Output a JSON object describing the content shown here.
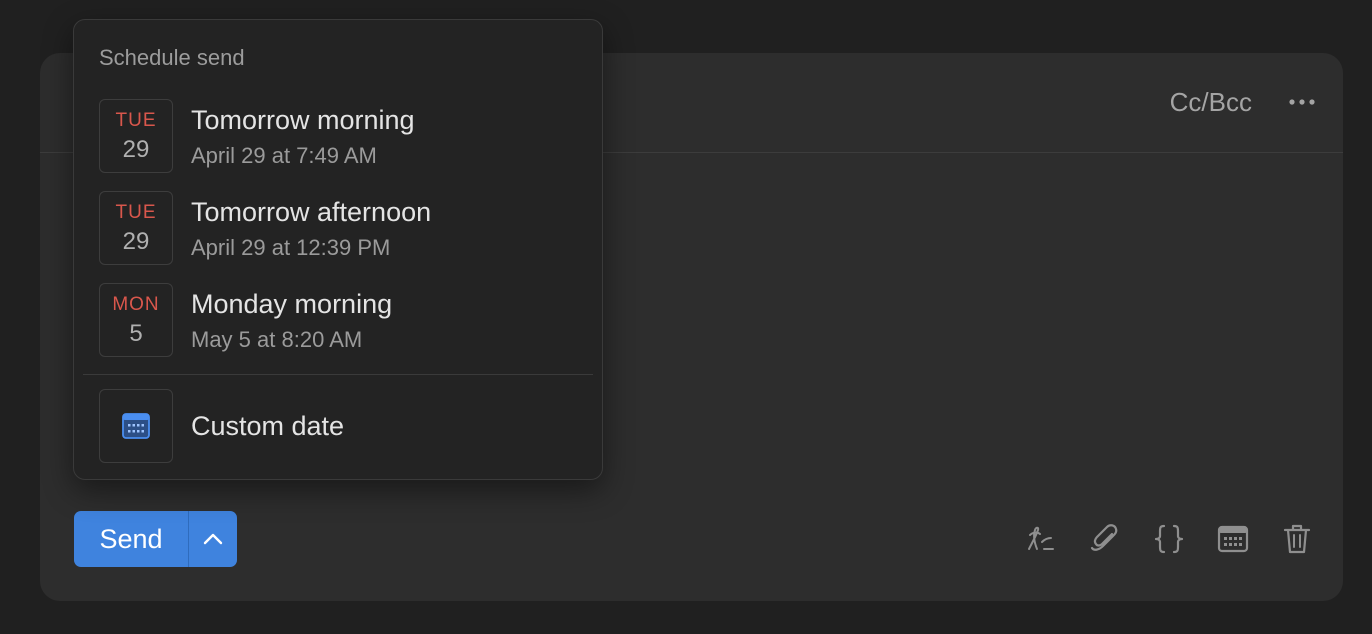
{
  "composer": {
    "cc_bcc_label": "Cc/Bcc",
    "more_icon": "more-horizontal-icon",
    "send_label": "Send",
    "send_options_icon": "chevron-up-icon",
    "toolbar": [
      {
        "icon": "signature-icon"
      },
      {
        "icon": "paperclip-icon"
      },
      {
        "icon": "braces-icon"
      },
      {
        "icon": "calendar-icon"
      },
      {
        "icon": "trash-icon"
      }
    ]
  },
  "schedule_popover": {
    "title": "Schedule send",
    "options": [
      {
        "dow": "TUE",
        "day": "29",
        "title": "Tomorrow morning",
        "subtitle": "April 29 at 7:49 AM"
      },
      {
        "dow": "TUE",
        "day": "29",
        "title": "Tomorrow afternoon",
        "subtitle": "April 29 at 12:39 PM"
      },
      {
        "dow": "MON",
        "day": "5",
        "title": "Monday morning",
        "subtitle": "May 5 at 8:20 AM"
      }
    ],
    "custom": {
      "icon": "calendar-icon",
      "label": "Custom date"
    }
  },
  "colors": {
    "accent": "#3f83de",
    "weekday": "#d9574c",
    "background": "#202020",
    "panel": "#2d2d2d",
    "popover": "#232323"
  }
}
